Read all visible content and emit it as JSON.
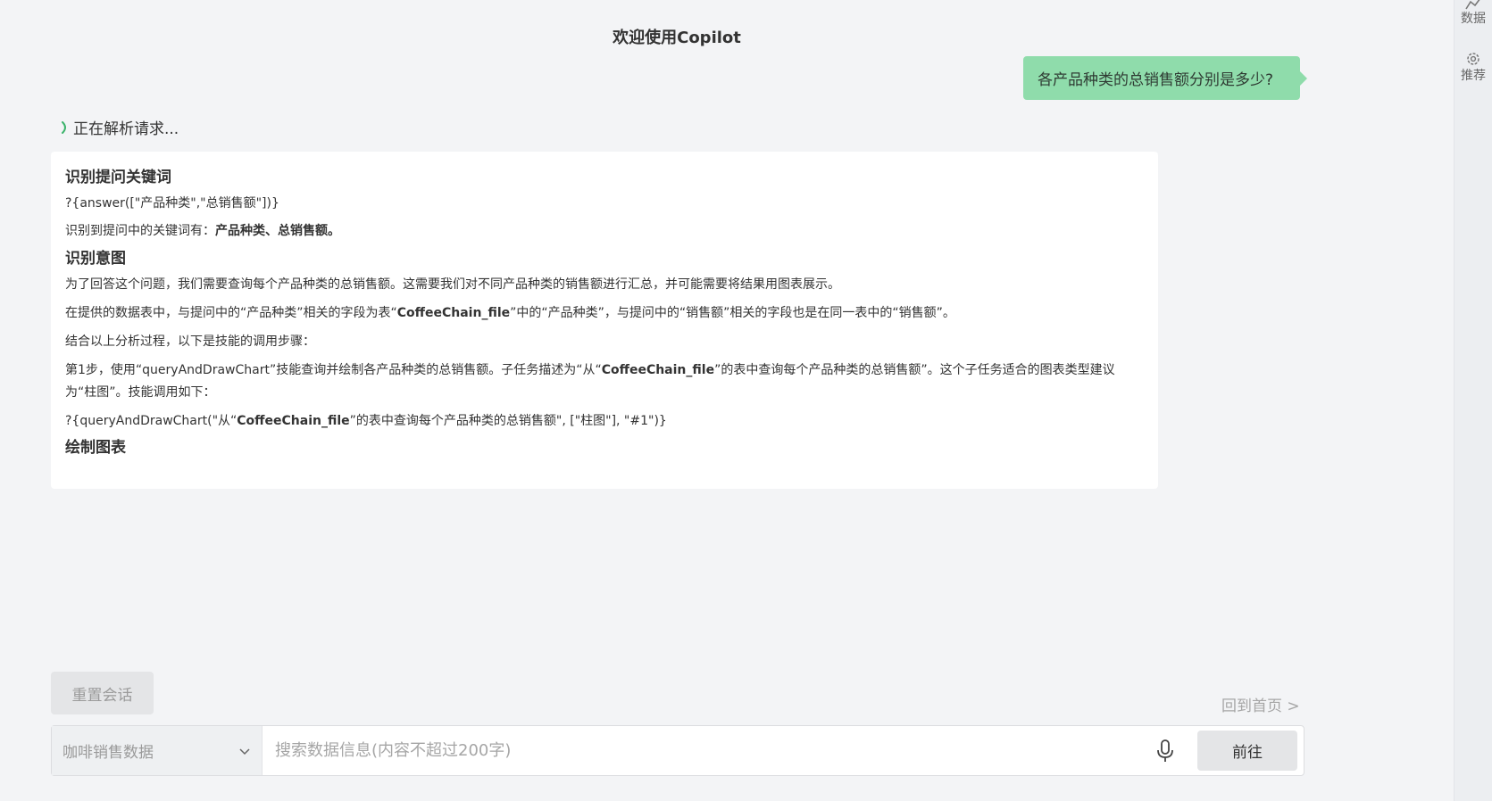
{
  "header": {
    "title": "欢迎使用Copilot"
  },
  "right_rail": {
    "data_label": "数据",
    "recommend_label": "推荐"
  },
  "chat": {
    "user_message": "各产品种类的总销售额分别是多少?",
    "status_text": "正在解析请求...",
    "response": {
      "section1_title": "识别提问关键词",
      "section1_code": "?{answer([\"产品种类\",\"总销售额\"])}",
      "section1_text_prefix": "识别到提问中的关键词有：",
      "section1_keywords": "产品种类、总销售额。",
      "section2_title": "识别意图",
      "section2_para1": "为了回答这个问题，我们需要查询每个产品种类的总销售额。这需要我们对不同产品种类的销售额进行汇总，并可能需要将结果用图表展示。",
      "section2_para2_a": "在提供的数据表中，与提问中的“产品种类”相关的字段为表“",
      "section2_para2_table": "CoffeeChain_file",
      "section2_para2_b": "”中的“产品种类”，与提问中的“销售额”相关的字段也是在同一表中的“销售额”。",
      "section2_para3": "结合以上分析过程，以下是技能的调用步骤：",
      "section2_para4_a": "第1步，使用“queryAndDrawChart”技能查询并绘制各产品种类的总销售额。子任务描述为“从“",
      "section2_para4_table": "CoffeeChain_file",
      "section2_para4_b": "”的表中查询每个产品种类的总销售额”。这个子任务适合的图表类型建议为“柱图”。技能调用如下：",
      "section2_code_a": "?{queryAndDrawChart(\"从“",
      "section2_code_table": "CoffeeChain_file",
      "section2_code_b": "”的表中查询每个产品种类的总销售额\", [\"柱图\"], \"#1\")}",
      "section3_title": "绘制图表"
    }
  },
  "controls": {
    "reset_label": "重置会话",
    "home_label": "回到首页 >",
    "dataset_value": "咖啡销售数据",
    "search_placeholder": "搜索数据信息(内容不超过200字)",
    "go_label": "前往"
  },
  "colors": {
    "background": "#f3f4f6",
    "user_bubble": "#8fdcab",
    "card": "#ffffff",
    "spinner": "#3bb36b"
  }
}
